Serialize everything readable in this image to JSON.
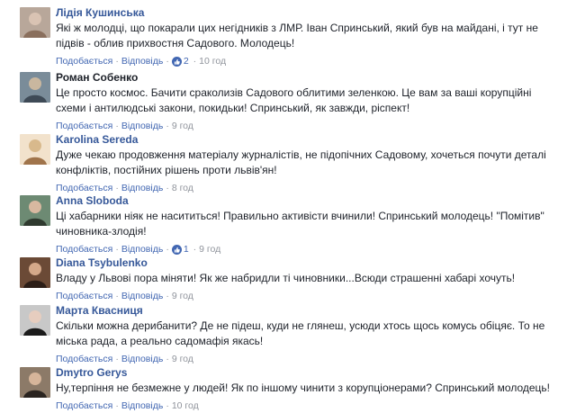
{
  "comments": [
    {
      "author": "Лідія Кушинська",
      "text": "Які ж молодці, що покарали цих негідників з ЛМР. Іван Спринський, який був на майдані, і тут не підвів - облив прихвостня Садового. Молодець!",
      "like_label": "Подобається",
      "reply_label": "Відповідь",
      "reactions": "2",
      "time": "10 год",
      "avatar_colors": [
        "#b8a79a",
        "#d9c3b3",
        "#8a6f5d"
      ]
    },
    {
      "author": "Роман Собенко",
      "text": "Це просто космос. Бачити сраколизів Садового облитими зеленкою. Це вам за ваші корупційні схеми і антилюдські закони, покидьки! Спринський, як завжди, ріспект!",
      "like_label": "Подобається",
      "reply_label": "Відповідь",
      "reactions": "",
      "time": "9 год",
      "avatar_colors": [
        "#7a8c99",
        "#3e4a56",
        "#c9b79f"
      ]
    },
    {
      "author": "Karolina Sereda",
      "text": "Дуже чекаю продовження матеріалу журналістів, не підопічних Садовому, хочеться почути деталі конфліктів, постійних рішень проти львів'ян!",
      "like_label": "Подобається",
      "reply_label": "Відповідь",
      "reactions": "",
      "time": "8 год",
      "avatar_colors": [
        "#d8b98c",
        "#a0744b",
        "#f2e2cc"
      ]
    },
    {
      "author": "Anna Sloboda",
      "text": "Ці хабарники ніяк не насититься! Правильно активісти вчинили! Спринський молодець! \"Помітив\" чиновника-злодія!",
      "like_label": "Подобається",
      "reply_label": "Відповідь",
      "reactions": "1",
      "time": "9 год",
      "avatar_colors": [
        "#6d8a73",
        "#2f3a2f",
        "#d8b8a0"
      ]
    },
    {
      "author": "Diana Tsybulenko",
      "text": "Владу у Львові пора міняти! Як же набридли ті чиновники...Всюди страшенні хабарі хочуть!",
      "like_label": "Подобається",
      "reply_label": "Відповідь",
      "reactions": "",
      "time": "9 год",
      "avatar_colors": [
        "#6b4a36",
        "#2c1e17",
        "#d4a98a"
      ]
    },
    {
      "author": "Марта Квасниця",
      "text": "Скільки можна дерибанити? Де не підеш, куди не глянеш, усюди хтось щось комусь обіцяє. То не міська рада, а реально садомафія якась!",
      "like_label": "Подобається",
      "reply_label": "Відповідь",
      "reactions": "",
      "time": "9 год",
      "avatar_colors": [
        "#c8c8c8",
        "#1b1b1b",
        "#e6cdbf"
      ]
    },
    {
      "author": "Dmytro Gerys",
      "text": "Ну,терпіння не безмежне у людей! Як по іншому чинити з корупціонерами? Спринський молодець!",
      "like_label": "Подобається",
      "reply_label": "Відповідь",
      "reactions": "",
      "time": "10 год",
      "avatar_colors": [
        "#8c7a68",
        "#2a2420",
        "#d6b59a"
      ]
    }
  ],
  "colors": {
    "author_link": "#365899",
    "action_link": "#4267b2",
    "meta_gray": "#90949c",
    "text": "#1d2129"
  }
}
